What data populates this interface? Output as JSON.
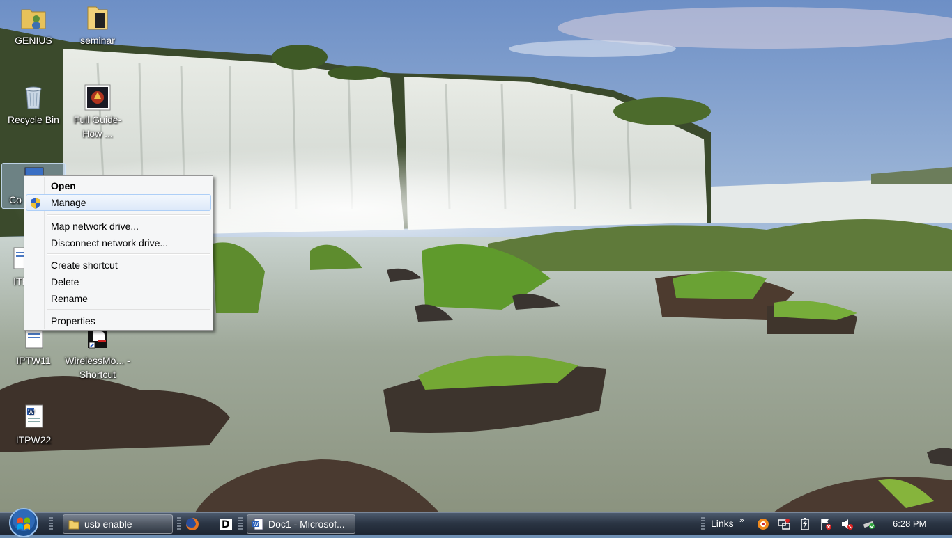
{
  "desktop": {
    "icons": [
      {
        "label": "GENIUS",
        "icon": "folder-user-icon"
      },
      {
        "label": "seminar",
        "icon": "folder-icon"
      },
      {
        "label": "Recycle Bin",
        "icon": "recycle-bin-icon"
      },
      {
        "label": "Full Guide-How ...",
        "icon": "video-thumbnail-icon"
      },
      {
        "label": "Co",
        "icon": "computer-icon"
      },
      {
        "label": "ITP",
        "icon": "document-icon"
      },
      {
        "label": "IPTW11",
        "icon": "document-icon"
      },
      {
        "label": "WirelessMo... - Shortcut",
        "icon": "shortcut-icon"
      },
      {
        "label": "ITPW22",
        "icon": "word-document-icon"
      }
    ]
  },
  "context_menu": {
    "items": [
      {
        "label": "Open",
        "bold": true
      },
      {
        "label": "Manage",
        "icon": "uac-shield-icon",
        "highlighted": true
      },
      {
        "label": "Map network drive..."
      },
      {
        "label": "Disconnect network drive..."
      },
      {
        "label": "Create shortcut"
      },
      {
        "label": "Delete"
      },
      {
        "label": "Rename"
      },
      {
        "label": "Properties"
      }
    ]
  },
  "taskbar": {
    "start": "windows-start-orb-icon",
    "windows": [
      {
        "label": "usb enable",
        "icon": "folder-icon"
      },
      {
        "label": "Doc1 - Microsof...",
        "icon": "word-icon"
      }
    ],
    "quick_launch": [
      "firefox-icon",
      "d-app-icon"
    ],
    "links_label": "Links",
    "links_chevron": "»",
    "tray_icons": [
      "orange-app-icon",
      "network-icon",
      "battery-icon",
      "flag-alert-icon",
      "volume-muted-icon",
      "safely-remove-icon"
    ],
    "clock": "6:28 PM"
  }
}
